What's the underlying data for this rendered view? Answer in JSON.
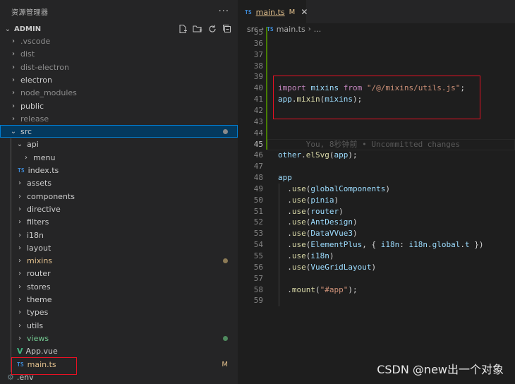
{
  "sidebar": {
    "title": "资源管理器",
    "more_icon": "ellipsis-icon",
    "project": "ADMIN",
    "actions": [
      "new-file-icon",
      "new-folder-icon",
      "refresh-icon",
      "collapse-all-icon"
    ]
  },
  "tree": [
    {
      "label": ".vscode",
      "style": "dim",
      "chev": "›"
    },
    {
      "label": "dist",
      "style": "dim",
      "chev": "›"
    },
    {
      "label": "dist-electron",
      "style": "dim",
      "chev": "›"
    },
    {
      "label": "electron",
      "style": "normal",
      "chev": "›"
    },
    {
      "label": "node_modules",
      "style": "dim",
      "chev": "›"
    },
    {
      "label": "public",
      "style": "normal",
      "chev": "›"
    },
    {
      "label": "release",
      "style": "dim",
      "chev": "›"
    },
    {
      "label": "src",
      "style": "normal",
      "chev": "⌄",
      "dot": "#8a8a8a",
      "selected": true
    },
    {
      "label": "api",
      "style": "normal",
      "chev": "⌄"
    },
    {
      "label": "menu",
      "style": "normal",
      "chev": "›"
    },
    {
      "label": "index.ts",
      "style": "normal",
      "icon": "TS"
    },
    {
      "label": "assets",
      "style": "normal",
      "chev": "›"
    },
    {
      "label": "components",
      "style": "normal",
      "chev": "›"
    },
    {
      "label": "directive",
      "style": "normal",
      "chev": "›"
    },
    {
      "label": "filters",
      "style": "normal",
      "chev": "›"
    },
    {
      "label": "i18n",
      "style": "normal",
      "chev": "›"
    },
    {
      "label": "layout",
      "style": "normal",
      "chev": "›"
    },
    {
      "label": "mixins",
      "style": "mod",
      "chev": "›",
      "dot": "#8c7a55"
    },
    {
      "label": "router",
      "style": "normal",
      "chev": "›"
    },
    {
      "label": "stores",
      "style": "normal",
      "chev": "›"
    },
    {
      "label": "theme",
      "style": "normal",
      "chev": "›"
    },
    {
      "label": "types",
      "style": "normal",
      "chev": "›"
    },
    {
      "label": "utils",
      "style": "normal",
      "chev": "›"
    },
    {
      "label": "views",
      "style": "green",
      "chev": "›",
      "dot": "#4f8a5e"
    },
    {
      "label": "App.vue",
      "style": "normal",
      "icon": "V"
    },
    {
      "label": "main.ts",
      "style": "mod",
      "icon": "TS",
      "badge": "M"
    },
    {
      "label": ".env",
      "style": "normal",
      "icon": "⚙"
    }
  ],
  "editor": {
    "tab": {
      "icon": "TS",
      "name": "main.ts",
      "modified": "M",
      "close": "✕"
    },
    "breadcrumb": {
      "folder": "src",
      "icon": "TS",
      "file": "main.ts",
      "rest": "..."
    }
  },
  "code": {
    "lines": [
      {
        "n": "35",
        "parts": []
      },
      {
        "n": "36",
        "parts": []
      },
      {
        "n": "37",
        "parts": []
      },
      {
        "n": "38",
        "parts": []
      },
      {
        "n": "39",
        "parts": []
      },
      {
        "n": "40",
        "parts": [
          [
            "kw",
            "import"
          ],
          [
            "pu",
            " "
          ],
          [
            "vr",
            "mixins"
          ],
          [
            "pu",
            " "
          ],
          [
            "kw",
            "from"
          ],
          [
            "pu",
            " "
          ],
          [
            "st",
            "\"/@/mixins/utils.js\""
          ],
          [
            "pu",
            ";"
          ]
        ]
      },
      {
        "n": "41",
        "parts": [
          [
            "vr",
            "app"
          ],
          [
            "pu",
            "."
          ],
          [
            "fn",
            "mixin"
          ],
          [
            "pu",
            "("
          ],
          [
            "vr",
            "mixins"
          ],
          [
            "pu",
            ");"
          ]
        ]
      },
      {
        "n": "42",
        "parts": []
      },
      {
        "n": "43",
        "parts": []
      },
      {
        "n": "44",
        "parts": []
      },
      {
        "n": "45",
        "parts": [
          [
            "ghost",
            "      You, 8秒钟前 • Uncommitted changes"
          ]
        ]
      },
      {
        "n": "46",
        "parts": [
          [
            "vr",
            "other"
          ],
          [
            "pu",
            "."
          ],
          [
            "fn",
            "elSvg"
          ],
          [
            "pu",
            "("
          ],
          [
            "vr",
            "app"
          ],
          [
            "pu",
            ");"
          ]
        ]
      },
      {
        "n": "47",
        "parts": []
      },
      {
        "n": "48",
        "parts": [
          [
            "vr",
            "app"
          ]
        ]
      },
      {
        "n": "49",
        "parts": [
          [
            "pu",
            "  ."
          ],
          [
            "fn",
            "use"
          ],
          [
            "pu",
            "("
          ],
          [
            "vr",
            "globalComponents"
          ],
          [
            "pu",
            ")"
          ]
        ]
      },
      {
        "n": "50",
        "parts": [
          [
            "pu",
            "  ."
          ],
          [
            "fn",
            "use"
          ],
          [
            "pu",
            "("
          ],
          [
            "vr",
            "pinia"
          ],
          [
            "pu",
            ")"
          ]
        ]
      },
      {
        "n": "51",
        "parts": [
          [
            "pu",
            "  ."
          ],
          [
            "fn",
            "use"
          ],
          [
            "pu",
            "("
          ],
          [
            "vr",
            "router"
          ],
          [
            "pu",
            ")"
          ]
        ]
      },
      {
        "n": "52",
        "parts": [
          [
            "pu",
            "  ."
          ],
          [
            "fn",
            "use"
          ],
          [
            "pu",
            "("
          ],
          [
            "vr",
            "AntDesign"
          ],
          [
            "pu",
            ")"
          ]
        ]
      },
      {
        "n": "53",
        "parts": [
          [
            "pu",
            "  ."
          ],
          [
            "fn",
            "use"
          ],
          [
            "pu",
            "("
          ],
          [
            "vr",
            "DataVVue3"
          ],
          [
            "pu",
            ")"
          ]
        ]
      },
      {
        "n": "54",
        "parts": [
          [
            "pu",
            "  ."
          ],
          [
            "fn",
            "use"
          ],
          [
            "pu",
            "("
          ],
          [
            "vr",
            "ElementPlus"
          ],
          [
            "pu",
            ", { "
          ],
          [
            "vr",
            "i18n"
          ],
          [
            "pu",
            ": "
          ],
          [
            "vr",
            "i18n"
          ],
          [
            "pu",
            "."
          ],
          [
            "vr",
            "global"
          ],
          [
            "pu",
            "."
          ],
          [
            "vr",
            "t"
          ],
          [
            "pu",
            " })"
          ]
        ]
      },
      {
        "n": "55",
        "parts": [
          [
            "pu",
            "  ."
          ],
          [
            "fn",
            "use"
          ],
          [
            "pu",
            "("
          ],
          [
            "vr",
            "i18n"
          ],
          [
            "pu",
            ")"
          ]
        ]
      },
      {
        "n": "56",
        "parts": [
          [
            "pu",
            "  ."
          ],
          [
            "fn",
            "use"
          ],
          [
            "pu",
            "("
          ],
          [
            "vr",
            "VueGridLayout"
          ],
          [
            "pu",
            ")"
          ]
        ]
      },
      {
        "n": "57",
        "parts": []
      },
      {
        "n": "58",
        "parts": [
          [
            "pu",
            "  ."
          ],
          [
            "fn",
            "mount"
          ],
          [
            "pu",
            "("
          ],
          [
            "st",
            "\"#app\""
          ],
          [
            "pu",
            ");"
          ]
        ]
      },
      {
        "n": "59",
        "parts": []
      }
    ]
  },
  "watermark": "CSDN @new出一个对象"
}
